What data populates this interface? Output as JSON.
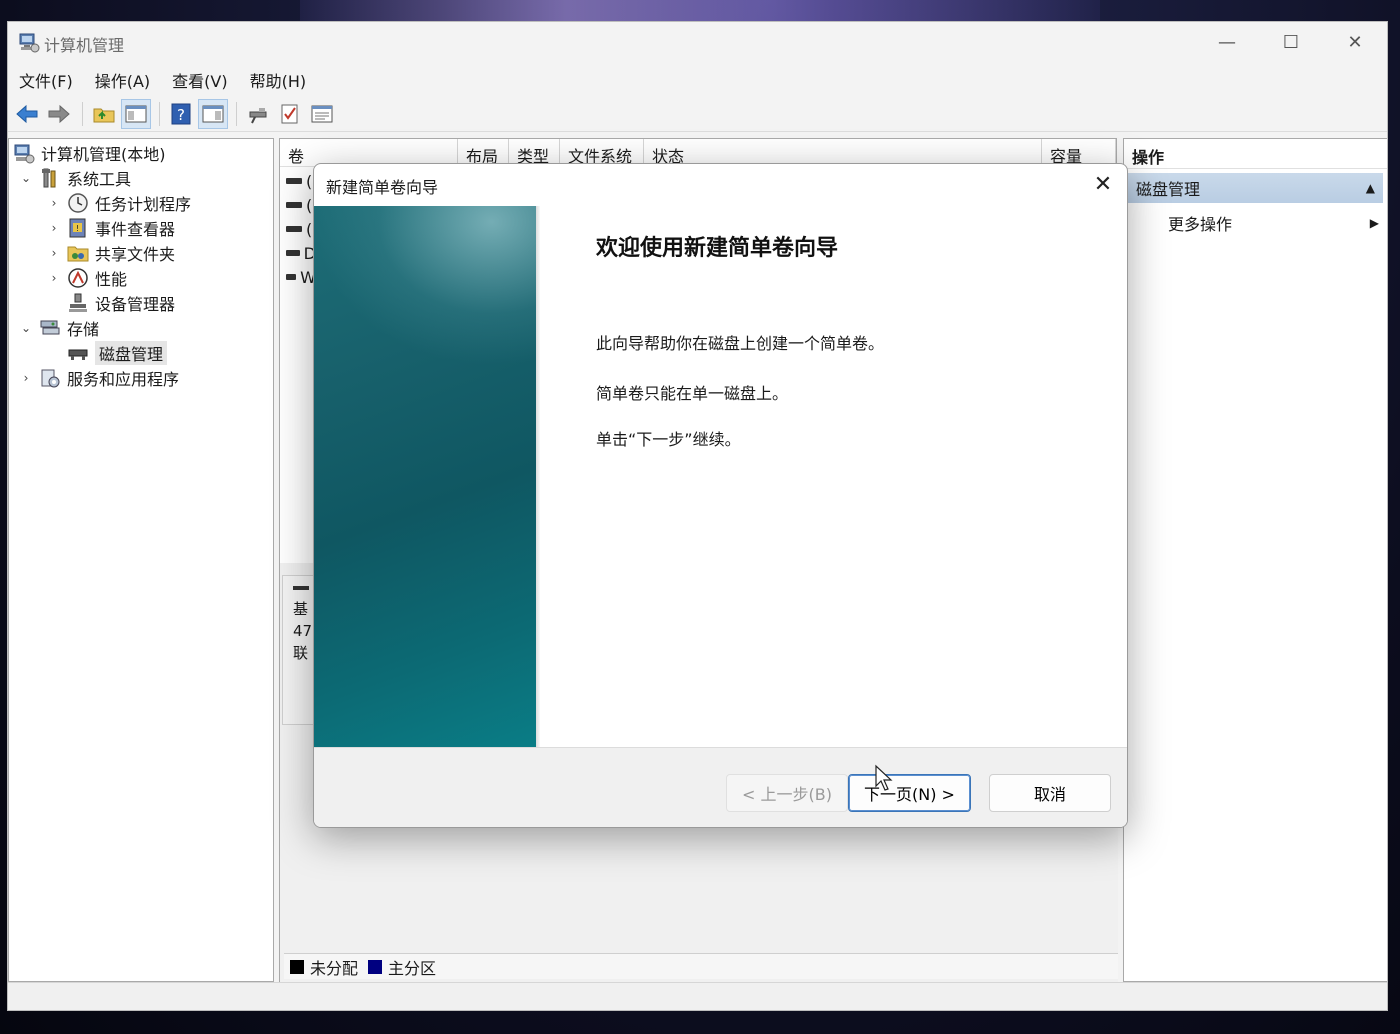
{
  "window": {
    "title": "计算机管理",
    "controls": {
      "minimize": "—",
      "maximize": "☐",
      "close": "✕"
    }
  },
  "menu": [
    "文件(F)",
    "操作(A)",
    "查看(V)",
    "帮助(H)"
  ],
  "tree": {
    "root": "计算机管理(本地)",
    "system_tools": "系统工具",
    "task_scheduler": "任务计划程序",
    "event_viewer": "事件查看器",
    "shared_folders": "共享文件夹",
    "performance": "性能",
    "device_manager": "设备管理器",
    "storage": "存储",
    "disk_management": "磁盘管理",
    "services_apps": "服务和应用程序"
  },
  "volume_table": {
    "columns": [
      "卷",
      "布局",
      "类型",
      "文件系统",
      "状态",
      "容量"
    ],
    "row_fragments": [
      "(",
      "(",
      "(",
      "D",
      "W"
    ]
  },
  "disk_panel": {
    "line1": "基",
    "line2": "47",
    "line3": "联"
  },
  "legend": {
    "unallocated": "未分配",
    "primary": "主分区",
    "unallocated_color": "#000000",
    "primary_color": "#000080"
  },
  "actions": {
    "header": "操作",
    "section": "磁盘管理",
    "more": "更多操作"
  },
  "dialog": {
    "title": "新建简单卷向导",
    "heading": "欢迎使用新建简单卷向导",
    "p1": "此向导帮助你在磁盘上创建一个简单卷。",
    "p2": "简单卷只能在单一磁盘上。",
    "p3": "单击“下一步”继续。",
    "back_label": "< 上一步(B)",
    "next_label": "下一页(N) >",
    "cancel_label": "取消",
    "close": "✕"
  }
}
